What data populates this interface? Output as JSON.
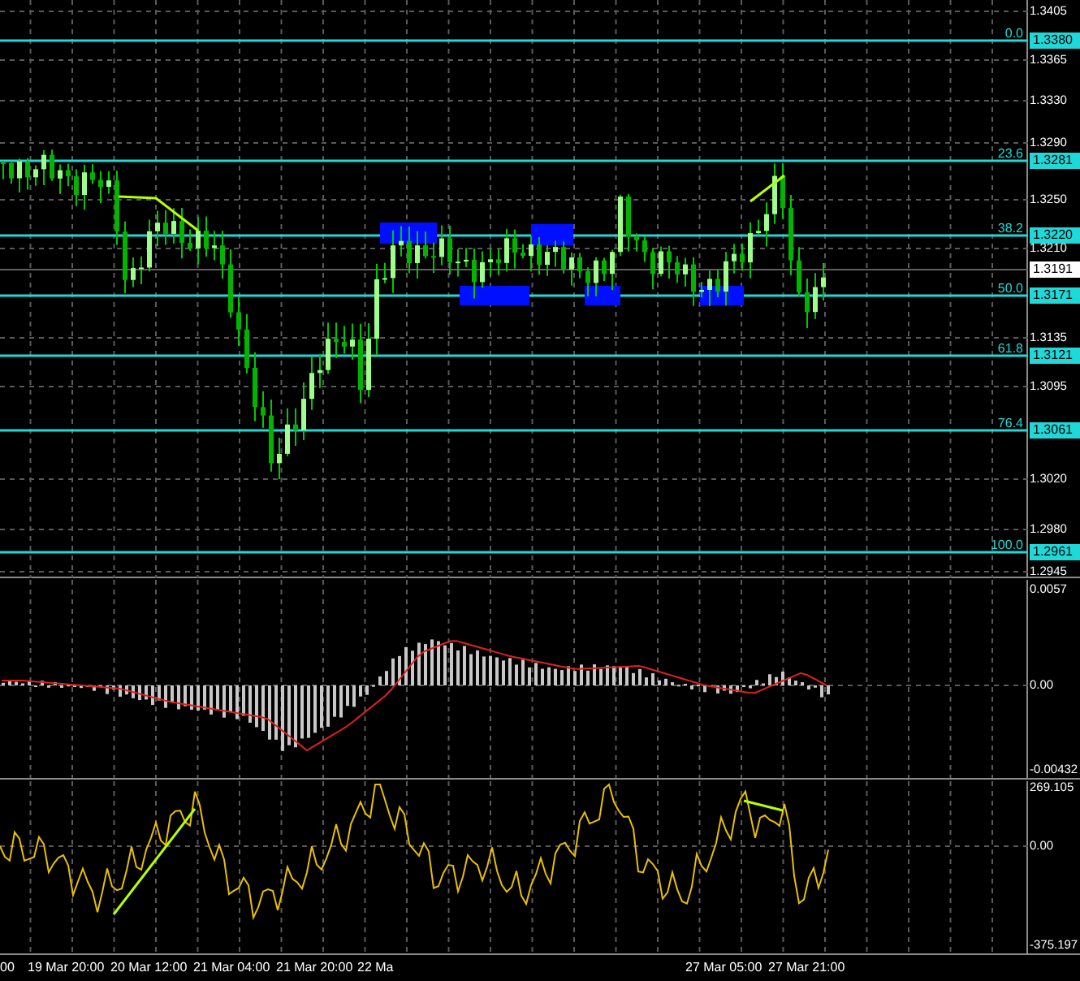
{
  "price_axis": {
    "ticks": [
      "1.3405",
      "1.3365",
      "1.3330",
      "1.3290",
      "1.3250",
      "1.3210",
      "1.3135",
      "1.3095",
      "1.3020",
      "1.2980",
      "1.2945"
    ],
    "current_price": "1.3191"
  },
  "fib_levels": [
    {
      "level": "0.0",
      "price": "1.3380"
    },
    {
      "level": "23.6",
      "price": "1.3281"
    },
    {
      "level": "38.2",
      "price": "1.3220"
    },
    {
      "level": "50.0",
      "price": "1.3171"
    },
    {
      "level": "61.8",
      "price": "1.3121"
    },
    {
      "level": "76.4",
      "price": "1.3061"
    },
    {
      "level": "100.0",
      "price": "1.2961"
    }
  ],
  "macd_axis": [
    "0.0057",
    "0.00",
    "-0.00432"
  ],
  "cci_axis": [
    "269.105",
    "0.00",
    "-375.197"
  ],
  "time_axis": [
    "00",
    "19 Mar 20:00",
    "20 Mar 12:00",
    "21 Mar 04:00",
    "21 Mar 20:00",
    "22 Ma",
    "27 Mar 05:00",
    "27 Mar 21:00"
  ]
}
